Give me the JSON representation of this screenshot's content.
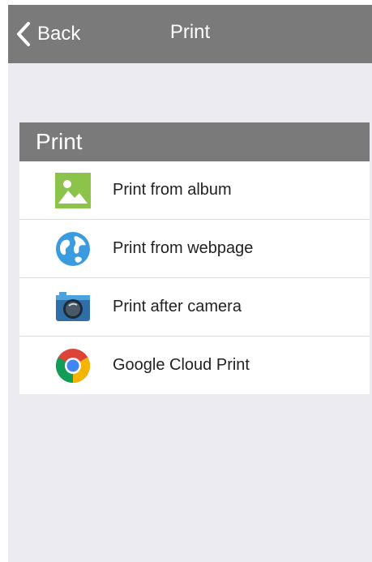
{
  "navbar": {
    "back_label": "Back",
    "title": "Print"
  },
  "section": {
    "header": "Print",
    "items": [
      {
        "label": "Print from album",
        "icon": "album-icon"
      },
      {
        "label": "Print from webpage",
        "icon": "globe-icon"
      },
      {
        "label": "Print after camera",
        "icon": "camera-icon"
      },
      {
        "label": "Google Cloud Print",
        "icon": "chrome-icon"
      }
    ]
  },
  "colors": {
    "navbar_bg": "#7a7a7a",
    "page_bg": "#ecebf1",
    "header_bg": "#7a7a7a"
  }
}
